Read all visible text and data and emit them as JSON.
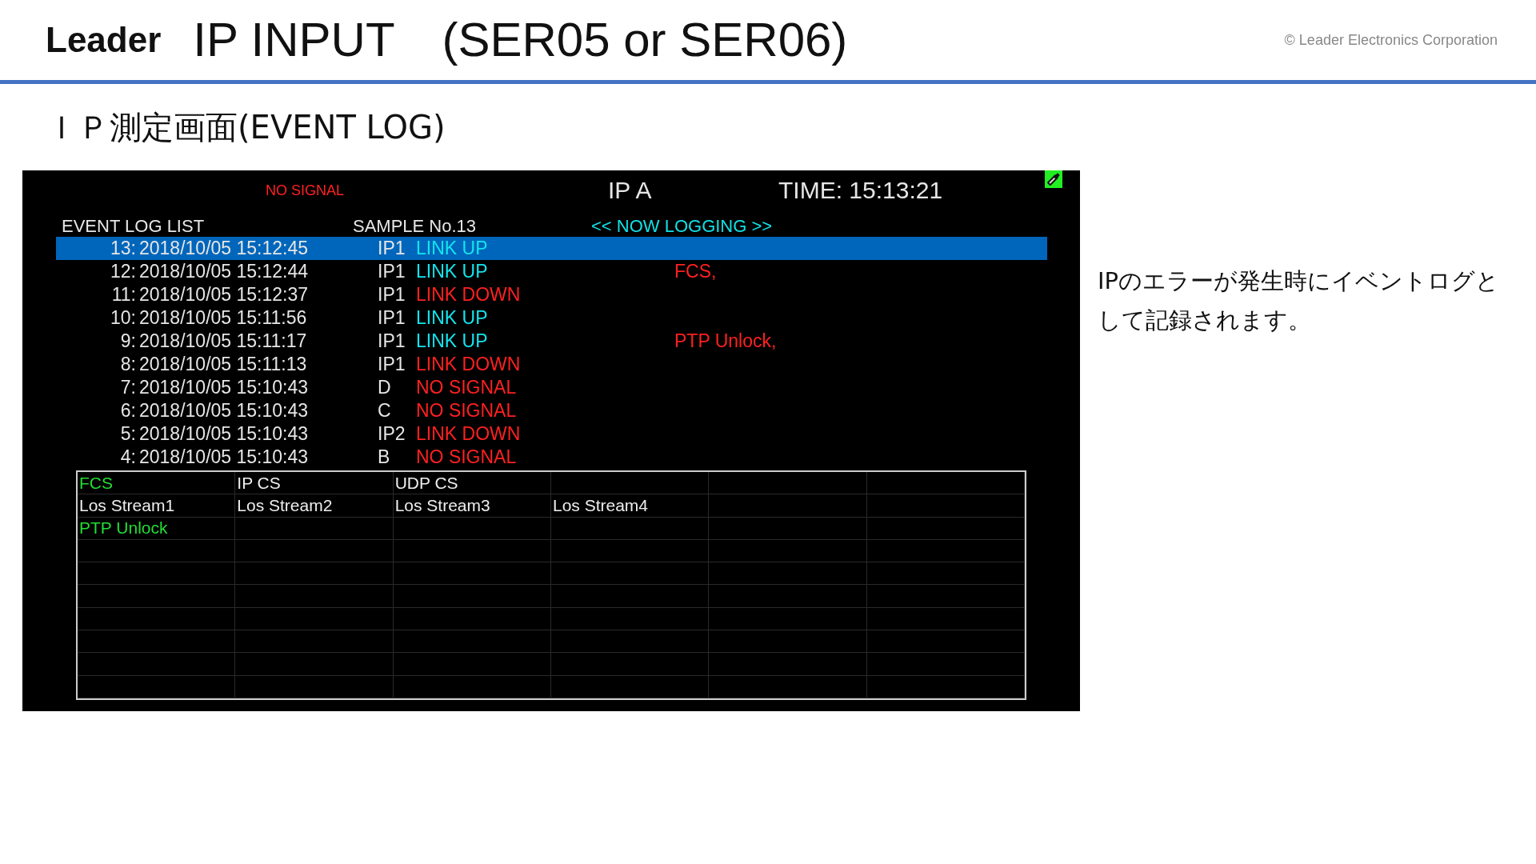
{
  "header": {
    "logo": "Leader",
    "title": "IP INPUT　(SER05 or SER06)",
    "copyright": "© Leader Electronics Corporation"
  },
  "subtitle": "ＩＰ測定画面(EVENT LOG)",
  "screen": {
    "signal_status": "NO SIGNAL",
    "input": "IP A",
    "time": "TIME: 15:13:21",
    "list_title": "EVENT LOG LIST",
    "sample": "SAMPLE No.13",
    "logging_status": "<< NOW LOGGING >>",
    "events": [
      {
        "number": "13:",
        "timestamp": "2018/10/05 15:12:45",
        "source": "IP1",
        "event": "LINK UP",
        "kind": "ok",
        "selected": true
      },
      {
        "number": "12:",
        "timestamp": "2018/10/05 15:12:44",
        "source": "IP1",
        "event": "LINK UP",
        "kind": "ok",
        "detail": "FCS,",
        "selected": false
      },
      {
        "number": "11:",
        "timestamp": "2018/10/05 15:12:37",
        "source": "IP1",
        "event": "LINK DOWN",
        "kind": "error",
        "selected": false
      },
      {
        "number": "10:",
        "timestamp": "2018/10/05 15:11:56",
        "source": "IP1",
        "event": "LINK UP",
        "kind": "ok",
        "selected": false
      },
      {
        "number": "9:",
        "timestamp": "2018/10/05 15:11:17",
        "source": "IP1",
        "event": "LINK UP",
        "kind": "ok",
        "detail": "PTP Unlock,",
        "selected": false
      },
      {
        "number": "8:",
        "timestamp": "2018/10/05 15:11:13",
        "source": "IP1",
        "event": "LINK DOWN",
        "kind": "error",
        "selected": false
      },
      {
        "number": "7:",
        "timestamp": "2018/10/05 15:10:43",
        "source": "D",
        "event": "NO SIGNAL",
        "kind": "error",
        "selected": false
      },
      {
        "number": "6:",
        "timestamp": "2018/10/05 15:10:43",
        "source": "C",
        "event": "NO SIGNAL",
        "kind": "error",
        "selected": false
      },
      {
        "number": "5:",
        "timestamp": "2018/10/05 15:10:43",
        "source": "IP2",
        "event": "LINK DOWN",
        "kind": "error",
        "selected": false
      },
      {
        "number": "4:",
        "timestamp": "2018/10/05 15:10:43",
        "source": "B",
        "event": "NO SIGNAL",
        "kind": "error",
        "selected": false
      }
    ],
    "error_table": [
      [
        {
          "label": "FCS",
          "detected": true
        },
        {
          "label": "IP CS",
          "detected": false
        },
        {
          "label": "UDP CS",
          "detected": false
        }
      ],
      [
        {
          "label": "Los Stream1",
          "detected": false
        },
        {
          "label": "Los Stream2",
          "detected": false
        },
        {
          "label": "Los Stream3",
          "detected": false
        },
        {
          "label": "Los Stream4",
          "detected": false
        }
      ],
      [
        {
          "label": "PTP Unlock",
          "detected": true
        }
      ]
    ]
  },
  "description": "IPのエラーが発生時にイベントログとして記録されます。"
}
